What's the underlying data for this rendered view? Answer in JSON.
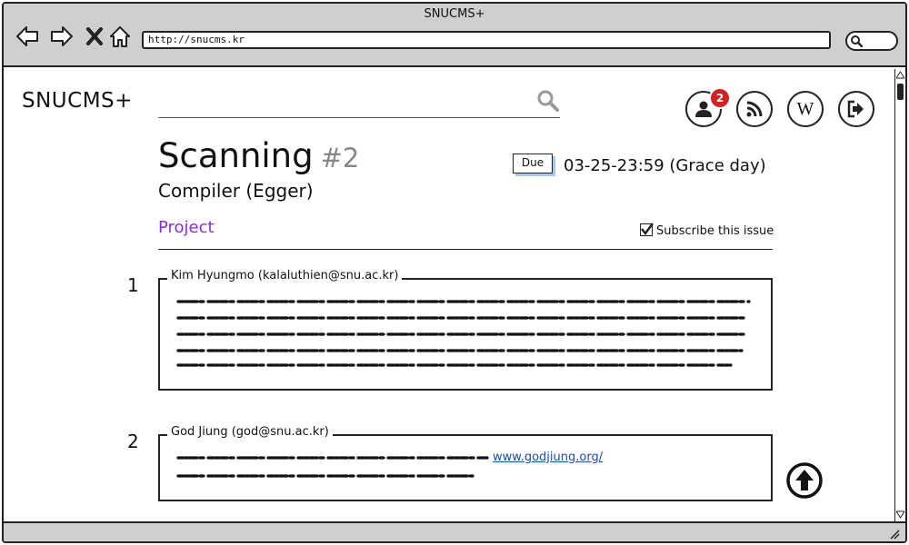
{
  "window": {
    "title": "SNUCMS+"
  },
  "browser": {
    "url": "http://snucms.kr"
  },
  "header": {
    "logo": "SNUCMS+",
    "search_placeholder": "",
    "notification_count": "2",
    "wiki_label": "W",
    "icons": [
      "user-icon",
      "rss-icon",
      "wiki-icon",
      "logout-icon"
    ]
  },
  "issue": {
    "title": "Scanning",
    "number": "#2",
    "course": "Compiler (Egger)",
    "due_label": "Due",
    "due_value": "03-25-23:59 (Grace day)",
    "category": "Project",
    "subscribe_label": "Subscribe this issue",
    "subscribed": true
  },
  "comments": [
    {
      "index": "1",
      "author": "Kim Hyungmo (kalaluthien@snu.ac.kr)"
    },
    {
      "index": "2",
      "author": "God Jiung (god@snu.ac.kr)",
      "link": "www.godjiung.org/"
    }
  ],
  "colors": {
    "accent": "#8a2be2",
    "badge": "#d32222",
    "link": "#1a4fb0",
    "due_shadow": "#a8c8ef"
  }
}
